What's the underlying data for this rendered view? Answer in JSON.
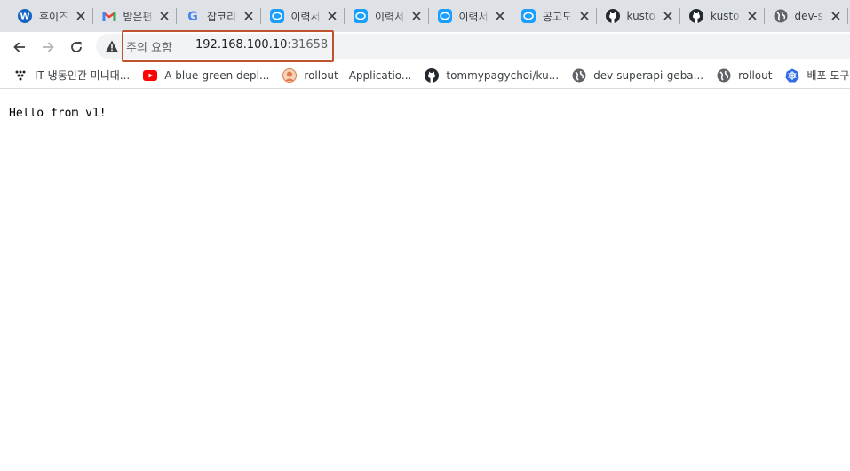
{
  "tabs": [
    {
      "title": "후이즈",
      "icon": "w-icon"
    },
    {
      "title": "받은편",
      "icon": "gmail-icon"
    },
    {
      "title": "잡코리",
      "icon": "google-icon"
    },
    {
      "title": "이력서",
      "icon": "chat-icon"
    },
    {
      "title": "이력서",
      "icon": "chat-icon"
    },
    {
      "title": "이력서",
      "icon": "chat-icon"
    },
    {
      "title": "공고도",
      "icon": "chat-icon"
    },
    {
      "title": "kusto",
      "icon": "github-icon"
    },
    {
      "title": "kusto",
      "icon": "github-icon"
    },
    {
      "title": "dev-s",
      "icon": "globe-icon"
    }
  ],
  "address": {
    "security_label": "주의 요함",
    "url_host": "192.168.100.10",
    "url_port": ":31658"
  },
  "bookmarks": [
    {
      "label": "IT 냉동인간 미니대...",
      "icon": "dots-icon"
    },
    {
      "label": "A blue-green depl...",
      "icon": "youtube-icon"
    },
    {
      "label": "rollout - Applicatio...",
      "icon": "avatar-icon"
    },
    {
      "label": "tommypagychoi/ku...",
      "icon": "github-icon"
    },
    {
      "label": "dev-superapi-geba...",
      "icon": "globe-icon"
    },
    {
      "label": "rollout",
      "icon": "globe-icon"
    },
    {
      "label": "배포 도구로 쿠",
      "icon": "kubernetes-icon"
    }
  ],
  "page": {
    "text": "Hello from v1!"
  },
  "colors": {
    "tabstrip_bg": "#dee1e6",
    "highlight_border": "#c0532f",
    "chat_blue": "#1a9fff",
    "gmail_red": "#ea4335"
  }
}
